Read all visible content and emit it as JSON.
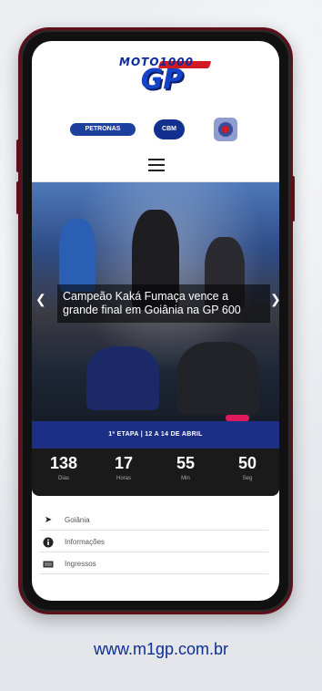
{
  "header": {
    "logo_moto": "MOTO1000",
    "logo_gp": "GP",
    "sponsors": [
      "PETRONAS",
      "CBM",
      ""
    ]
  },
  "menu": {
    "icon": "hamburger-menu-icon"
  },
  "hero": {
    "headline": "Campeão Kaká Fumaça vence a grande final em Goiânia na GP 600"
  },
  "event": {
    "stage": "1ª ETAPA | 12 A 14 DE ABRIL"
  },
  "countdown": [
    {
      "value": "138",
      "label": "Dias"
    },
    {
      "value": "17",
      "label": "Horas"
    },
    {
      "value": "55",
      "label": "Min"
    },
    {
      "value": "50",
      "label": "Seg"
    }
  ],
  "nav": [
    {
      "icon": "location-arrow-icon",
      "label": "Goiânia"
    },
    {
      "icon": "info-icon",
      "label": "Informações"
    },
    {
      "icon": "ticket-icon",
      "label": "Ingressos"
    }
  ],
  "footer": {
    "url": "www.m1gp.com.br"
  },
  "colors": {
    "brand_blue": "#1c2f85",
    "brand_red": "#d11a22",
    "frame": "#5e0f1a",
    "url_text": "#0b2f93"
  }
}
